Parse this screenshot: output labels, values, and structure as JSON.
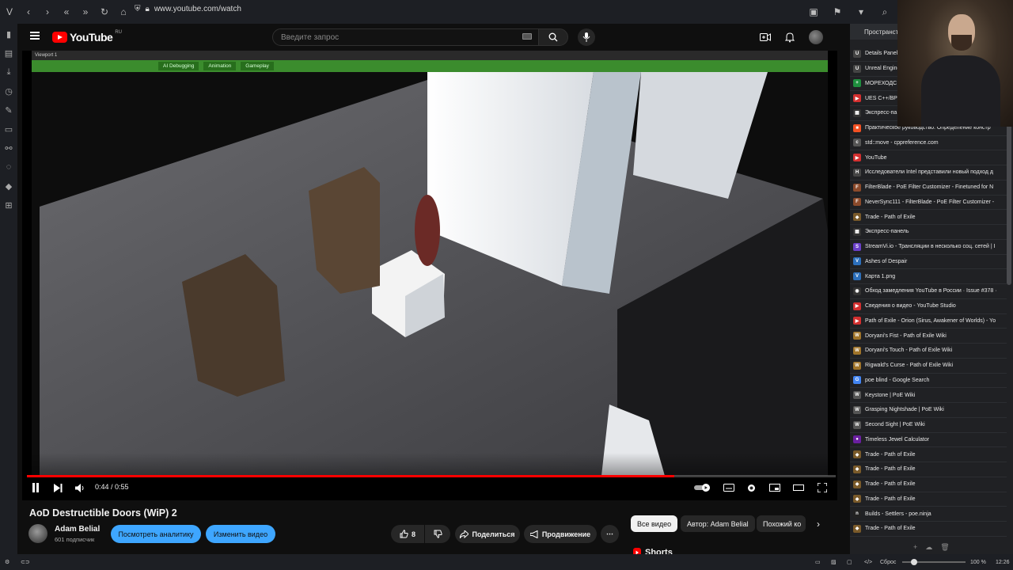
{
  "browser": {
    "url": "www.youtube.com/watch",
    "clock": "12:26",
    "zoom": "100 %",
    "reset_label": "Сброс"
  },
  "youtube": {
    "logo_text": "YouTube",
    "region": "RU",
    "search_placeholder": "Введите запрос"
  },
  "player": {
    "viewport_label": "Viewport 1",
    "ue_tabs": [
      "AI Debugging",
      "Animation",
      "Gameplay"
    ],
    "time": "0:44 / 0:55",
    "progress": 0.8
  },
  "video": {
    "title": "AoD Destructible Doors (WiP) 2",
    "channel": "Adam Belial",
    "subscribers": "601 подписчик",
    "analytics_btn": "Посмотреть аналитику",
    "edit_btn": "Изменить видео",
    "likes": "8",
    "share_btn": "Поделиться",
    "promote_btn": "Продвижение"
  },
  "chips": {
    "all": "Все видео",
    "author": "Автор: Adam Belial",
    "similar": "Похожий ко"
  },
  "shorts_label": "Shorts",
  "bookmarks": {
    "header": "Пространств",
    "items": [
      {
        "label": "Details Panel",
        "fav": "U",
        "color": "#444"
      },
      {
        "label": "Unreal Engine",
        "fav": "U",
        "color": "#444"
      },
      {
        "label": "МОРЕХОДС",
        "fav": "+",
        "color": "#1e8e3e"
      },
      {
        "label": "UES C++/BP",
        "fav": "▶",
        "color": "#d32f2f"
      },
      {
        "label": "Экспресс-па",
        "fav": "▦",
        "color": "#333"
      },
      {
        "label": "Практическое руководство. Определение констр",
        "fav": "■",
        "color": "#f25022"
      },
      {
        "label": "std::move - cppreference.com",
        "fav": "c",
        "color": "#555"
      },
      {
        "label": "YouTube",
        "fav": "▶",
        "color": "#d32f2f"
      },
      {
        "label": "Исследователи Intel представили новый подход д",
        "fav": "H",
        "color": "#444"
      },
      {
        "label": "FilterBlade - PoE Filter Customizer - Finetuned for N",
        "fav": "F",
        "color": "#8b4a2b"
      },
      {
        "label": "NeverSync111 - FilterBlade - PoE Filter Customizer -",
        "fav": "F",
        "color": "#8b4a2b"
      },
      {
        "label": "Trade - Path of Exile",
        "fav": "◆",
        "color": "#7a5a2a"
      },
      {
        "label": "Экспресс-панель",
        "fav": "▦",
        "color": "#333"
      },
      {
        "label": "StreamVi.io - Трансляции в несколько соц. сетей | I",
        "fav": "S",
        "color": "#6a3fc9"
      },
      {
        "label": "Ashes of Despair",
        "fav": "V",
        "color": "#2c6fbb"
      },
      {
        "label": "Карта 1.png",
        "fav": "V",
        "color": "#2c6fbb"
      },
      {
        "label": "Обход замедления YouTube в России · Issue #378 ·",
        "fav": "◉",
        "color": "#333"
      },
      {
        "label": "Сведения о видео - YouTube Studio",
        "fav": "▶",
        "color": "#d32f2f"
      },
      {
        "label": "Path of Exile - Orion (Sirus, Awakener of Worlds) - Yo",
        "fav": "▶",
        "color": "#d32f2f"
      },
      {
        "label": "Doryani's Fist - Path of Exile Wiki",
        "fav": "W",
        "color": "#a0742a"
      },
      {
        "label": "Doryani's Touch - Path of Exile Wiki",
        "fav": "W",
        "color": "#a0742a"
      },
      {
        "label": "Rigwald's Curse - Path of Exile Wiki",
        "fav": "W",
        "color": "#a0742a"
      },
      {
        "label": "poe blind - Google Search",
        "fav": "G",
        "color": "#4285f4"
      },
      {
        "label": "Keystone | PoE Wiki",
        "fav": "W",
        "color": "#555"
      },
      {
        "label": "Grasping Nightshade | PoE Wiki",
        "fav": "W",
        "color": "#555"
      },
      {
        "label": "Second Sight | PoE Wiki",
        "fav": "W",
        "color": "#555"
      },
      {
        "label": "Timeless Jewel Calculator",
        "fav": "●",
        "color": "#6a1fa0"
      },
      {
        "label": "Trade - Path of Exile",
        "fav": "◆",
        "color": "#7a5a2a"
      },
      {
        "label": "Trade - Path of Exile",
        "fav": "◆",
        "color": "#7a5a2a"
      },
      {
        "label": "Trade - Path of Exile",
        "fav": "◆",
        "color": "#7a5a2a"
      },
      {
        "label": "Trade - Path of Exile",
        "fav": "◆",
        "color": "#7a5a2a"
      },
      {
        "label": "Builds - Settlers - poe.ninja",
        "fav": "n",
        "color": "#222"
      },
      {
        "label": "Trade - Path of Exile",
        "fav": "◆",
        "color": "#7a5a2a"
      }
    ]
  }
}
